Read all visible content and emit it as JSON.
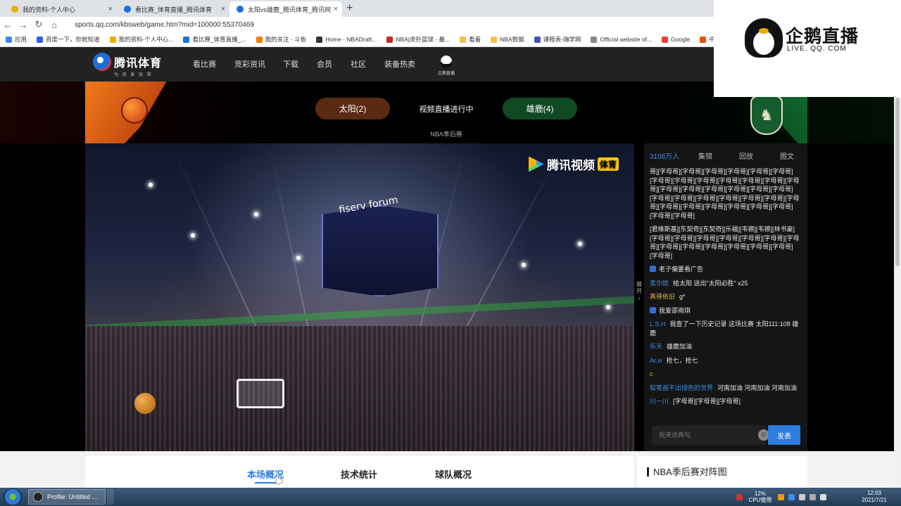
{
  "browser": {
    "tabs": [
      {
        "title": "我的资料-个人中心",
        "active": false,
        "favicon_color": "#e8b000"
      },
      {
        "title": "看比赛_体育直播_腾讯体育",
        "active": false,
        "favicon_color": "#1b6fd8"
      },
      {
        "title": "太阳vs雄鹿_腾讯体育_腾讯网",
        "active": true,
        "favicon_color": "#1b6fd8"
      }
    ],
    "new_tab": "+",
    "url": "sports.qq.com/kbsweb/game.htm?mid=100000:55370469",
    "bookmarks": [
      {
        "label": "应用",
        "color": "#4285f4"
      },
      {
        "label": "百度一下，你就知道",
        "color": "#2d5be3"
      },
      {
        "label": "我的资料-个人中心...",
        "color": "#e8b000"
      },
      {
        "label": "看比赛_体育直播_...",
        "color": "#1b6fd8"
      },
      {
        "label": "我的关注 - 斗鱼",
        "color": "#f57c00"
      },
      {
        "label": "Home - NBADraft...",
        "color": "#333333"
      },
      {
        "label": "NBA|虎扑篮球 - 最...",
        "color": "#c62828"
      },
      {
        "label": "看着",
        "color": "#f2c14e"
      },
      {
        "label": "NBA数据",
        "color": "#f2c14e"
      },
      {
        "label": "课程表-嗨学网",
        "color": "#3f51b5"
      },
      {
        "label": "Official website of...",
        "color": "#888888"
      },
      {
        "label": "Google",
        "color": "#ea4335"
      },
      {
        "label": "中国",
        "color": "#e65100"
      }
    ]
  },
  "site": {
    "logo_text": "腾讯体育",
    "logo_slogan": "为 热 爱 加 零",
    "nav": [
      "看比赛",
      "竞彩资讯",
      "下载",
      "会员",
      "社区",
      "装备热卖"
    ],
    "qie_label": "企鹅直播"
  },
  "match": {
    "home_team": "太阳(2)",
    "away_team": "雄鹿(4)",
    "status": "视频直播进行中",
    "stage": "NBA季后赛"
  },
  "video": {
    "watermark_text": "腾讯视频",
    "watermark_tag": "体育",
    "arena_text": "fiserv forum",
    "collapse_label": "展开"
  },
  "chat": {
    "tabs": [
      "3108万人",
      "集锦",
      "回放",
      "图文"
    ],
    "messages": [
      {
        "user": "",
        "text": "哥][字母哥][字母哥][字母哥][字母哥][字母哥][字母哥][字母哥][字母哥][字母哥][字母哥][字母哥][字母哥][字母哥][字母哥][字母哥][字母哥][字母哥][字母哥][字母哥][字母哥][字母哥][字母哥][字母哥][字母哥][字母哥][字母哥][字母哥][字母哥][字母哥][字母哥][字母哥][字母哥][字母哥][字母哥]"
      },
      {
        "user": "",
        "text": "[君维斯基][东契奇][东契奇][乐福][韦德][韦德][林书豪][字母哥][字母哥][字母哥][字母哥][字母哥][字母哥][字母哥][字母哥][字母哥][字母哥][字母哥][字母哥][字母哥][字母哥]"
      },
      {
        "user": "",
        "text": "老子偏要看广告",
        "level": true
      },
      {
        "user": "卖尔斑",
        "text": "给太阳 送出“太阳必胜” x25"
      },
      {
        "user": "真得依旧",
        "text": "g*",
        "gold": true
      },
      {
        "user": "",
        "text": "我爱邵雨琪",
        "level": true
      },
      {
        "user": "L.S.H",
        "text": "我查了一下历史记录 这场比赛 太阳111:108 雄鹿"
      },
      {
        "user": "乐天",
        "text": "雄鹿加油"
      },
      {
        "user": "Ar.xi",
        "text": "抢七，抢七"
      },
      {
        "user": "c",
        "text": "",
        "gold": true
      },
      {
        "user": "铅笔画不出绿色的世界",
        "text": "河南加油 河南加油 河南加油"
      },
      {
        "user": "川一川",
        "text": "[字母哥][字母哥][字母哥]"
      }
    ],
    "input_placeholder": "我来说两句",
    "emoji_icon": "☺",
    "send_label": "发表"
  },
  "info_tabs": [
    "本场概况",
    "技术统计",
    "球队概况"
  ],
  "bracket_title": "NBA季后赛对阵图",
  "overlay": {
    "brand": "企鹅直播",
    "url": "LIVE. QQ. COM"
  },
  "taskbar": {
    "app": "Profile: Untitled ...",
    "cpu_percent": "12%",
    "cpu_label": "CPU使用",
    "time": "12:03",
    "date": "2021/7/21"
  }
}
